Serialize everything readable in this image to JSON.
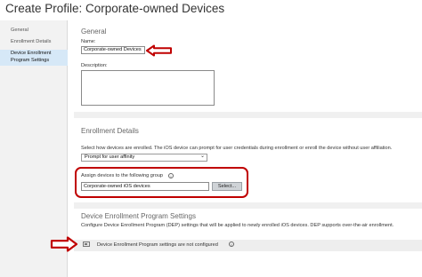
{
  "window": {
    "title": "Create Profile: Corporate-owned Devices"
  },
  "sidebar": {
    "items": [
      {
        "label": "General",
        "active": false
      },
      {
        "label": "Enrollment Details",
        "active": false
      },
      {
        "label": "Device Enrollment Program Settings",
        "active": true
      }
    ]
  },
  "general": {
    "heading": "General",
    "name_label": "Name:",
    "name_value": "Corporate-owned Devices",
    "description_label": "Description:",
    "description_value": ""
  },
  "enrollment": {
    "heading": "Enrollment Details",
    "description": "Select how devices are enrolled. The iOS device can prompt for user credentials during enrollment or enroll the device without user affiliation.",
    "affinity_selected": "Prompt for user affinity",
    "assign_label": "Assign devices to the following group",
    "group_value": "Corporate-owned iOS devices",
    "select_button": "Select..."
  },
  "dep": {
    "heading": "Device Enrollment Program Settings",
    "description": "Configure Device Enrollment Program (DEP) settings that will be applied to newly enrolled iOS devices. DEP supports over-the-air enrollment.",
    "status_text": "Device Enrollment Program settings are not configured"
  },
  "icons": {
    "info": "info-icon",
    "arrow": "red-arrow-icon",
    "status": "settings-not-configured-icon",
    "dropdown": "chevron-down-icon"
  },
  "colors": {
    "annotation_red": "#c00000",
    "active_nav": "#d6e8f7"
  }
}
